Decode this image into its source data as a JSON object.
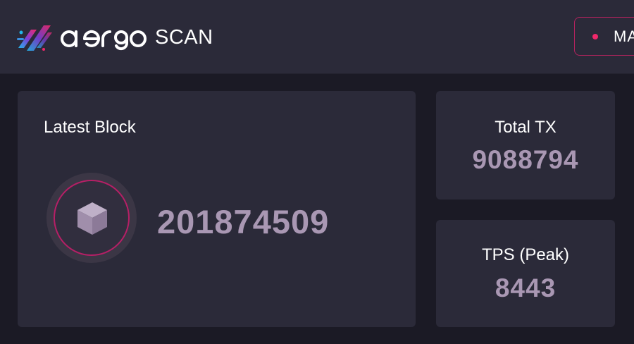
{
  "header": {
    "logo_text": "aergo",
    "logo_suffix": "SCAN",
    "network_label": "MA"
  },
  "latest_block": {
    "title": "Latest Block",
    "number": "201874509"
  },
  "total_tx": {
    "title": "Total TX",
    "value": "9088794"
  },
  "tps": {
    "title": "TPS (Peak)",
    "value": "8443"
  },
  "colors": {
    "background": "#1b1a25",
    "card": "#2b2a39",
    "accent": "#f0286b",
    "value_text": "#a997b3"
  }
}
